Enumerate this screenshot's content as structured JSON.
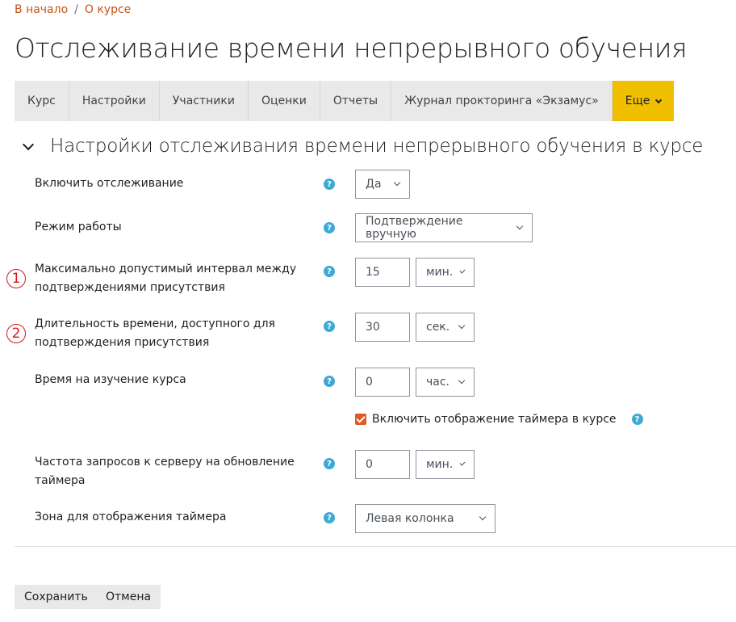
{
  "breadcrumb": {
    "home": "В начало",
    "separator": "/",
    "current": "О курсе"
  },
  "page": {
    "title": "Отслеживание времени непрерывного обучения"
  },
  "tabs": [
    {
      "label": "Курс"
    },
    {
      "label": "Настройки"
    },
    {
      "label": "Участники"
    },
    {
      "label": "Оценки"
    },
    {
      "label": "Отчеты"
    },
    {
      "label": "Журнал прокторинга «Экзамус»"
    },
    {
      "label": "Еще"
    }
  ],
  "section": {
    "title": "Настройки отслеживания времени непрерывного обучения в курсе"
  },
  "help_glyph": "?",
  "form": {
    "enable": {
      "label": "Включить отслеживание",
      "value": "Да"
    },
    "mode": {
      "label": "Режим работы",
      "value": "Подтверждение вручную"
    },
    "max_interval": {
      "marker": "1",
      "label": "Максимально допустимый интервал между подтверждениями присутствия",
      "value": "15",
      "unit": "мин."
    },
    "duration": {
      "marker": "2",
      "label": "Длительность времени, доступного для подтверждения присутствия",
      "value": "30",
      "unit": "сек."
    },
    "study_time": {
      "label": "Время на изучение курса",
      "value": "0",
      "unit": "час."
    },
    "show_timer": {
      "label": "Включить отображение таймера в курсе",
      "checked": true
    },
    "request_freq": {
      "label": "Частота запросов к серверу на обновление таймера",
      "value": "0",
      "unit": "мин."
    },
    "timer_zone": {
      "label": "Зона для отображения таймера",
      "value": "Левая колонка"
    }
  },
  "buttons": {
    "save": "Сохранить",
    "cancel": "Отмена"
  },
  "colors": {
    "accent": "#c4541b",
    "tab_more": "#f0c000",
    "help": "#3fa9d6",
    "checkbox": "#e0591e",
    "marker": "#d9141b"
  }
}
